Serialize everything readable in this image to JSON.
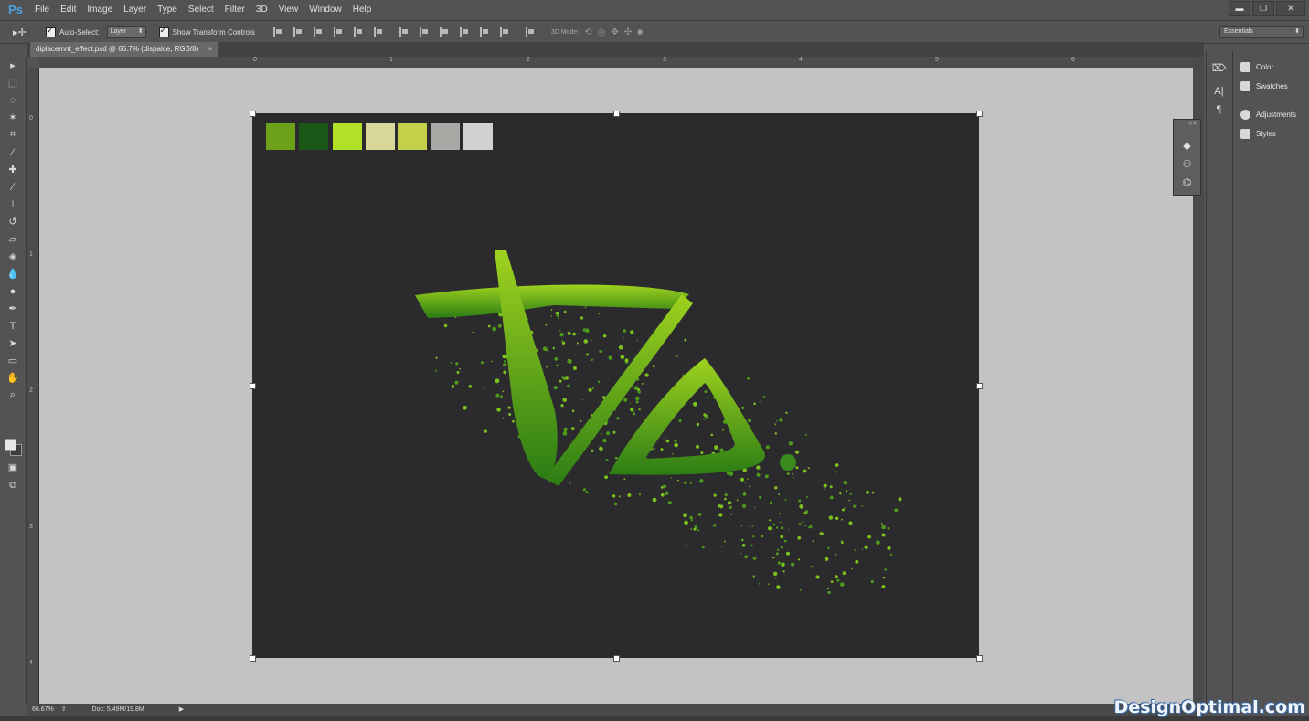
{
  "app": {
    "logo": "Ps"
  },
  "menu": [
    "File",
    "Edit",
    "Image",
    "Layer",
    "Type",
    "Select",
    "Filter",
    "3D",
    "View",
    "Window",
    "Help"
  ],
  "window_controls": {
    "minimize": "▬",
    "restore": "❐",
    "close": "✕"
  },
  "options": {
    "tool_glyph": "▸✛",
    "auto_select_label": "Auto-Select:",
    "auto_select_checked": true,
    "layer_dropdown": "Layer",
    "show_transform_label": "Show Transform Controls",
    "show_transform_checked": true,
    "mode_3d_label": "3D Mode:",
    "workspace": "Essentials"
  },
  "document": {
    "tab_title": "diplacemnt_effect.psd @ 66.7% (dispalce, RGB/8)",
    "tab_close": "×",
    "zoom": "66.67%",
    "doc_info": "Doc: 5.49M/19.8M"
  },
  "ruler": {
    "horizontal": [
      "0",
      "1",
      "2",
      "3",
      "4",
      "5",
      "6"
    ],
    "vertical": [
      "0",
      "1",
      "2",
      "3",
      "4"
    ]
  },
  "canvas": {
    "background": "#2b2a2d",
    "palette": [
      "#6da11a",
      "#1b5716",
      "#b0e029",
      "#d8d698",
      "#c4cf4a",
      "#a9a8a4",
      "#d0d2d0"
    ],
    "artwork": "green brush-stroke monogram with scattered splatter particles"
  },
  "tools": [
    {
      "name": "move-tool",
      "glyph": "▸"
    },
    {
      "name": "marquee-tool",
      "glyph": "⬚"
    },
    {
      "name": "lasso-tool",
      "glyph": "◌"
    },
    {
      "name": "magic-wand-tool",
      "glyph": "✶"
    },
    {
      "name": "crop-tool",
      "glyph": "⌗"
    },
    {
      "name": "eyedropper-tool",
      "glyph": "⁄"
    },
    {
      "name": "healing-brush-tool",
      "glyph": "✚"
    },
    {
      "name": "brush-tool",
      "glyph": "∕"
    },
    {
      "name": "clone-stamp-tool",
      "glyph": "⊥"
    },
    {
      "name": "history-brush-tool",
      "glyph": "↺"
    },
    {
      "name": "eraser-tool",
      "glyph": "▱"
    },
    {
      "name": "paint-bucket-tool",
      "glyph": "◈"
    },
    {
      "name": "blur-tool",
      "glyph": "💧"
    },
    {
      "name": "dodge-tool",
      "glyph": "●"
    },
    {
      "name": "pen-tool",
      "glyph": "✒"
    },
    {
      "name": "type-tool",
      "glyph": "T"
    },
    {
      "name": "path-selection-tool",
      "glyph": "➤"
    },
    {
      "name": "rectangle-tool",
      "glyph": "▭"
    },
    {
      "name": "hand-tool",
      "glyph": "✋"
    },
    {
      "name": "zoom-tool",
      "glyph": "⌕"
    }
  ],
  "panels": {
    "mini": [
      {
        "name": "history-icon",
        "glyph": "⌦"
      },
      {
        "name": "character-icon",
        "glyph": "A|"
      },
      {
        "name": "paragraph-icon",
        "glyph": "¶"
      }
    ],
    "dock": [
      {
        "label": "Color"
      },
      {
        "label": "Swatches"
      },
      {
        "label": "Adjustments"
      },
      {
        "label": "Styles"
      }
    ],
    "floating": [
      {
        "name": "layers-icon",
        "glyph": "◆"
      },
      {
        "name": "channels-icon",
        "glyph": "⚇"
      },
      {
        "name": "paths-icon",
        "glyph": "⌬"
      }
    ]
  },
  "watermark": "DesignOptimal.com"
}
